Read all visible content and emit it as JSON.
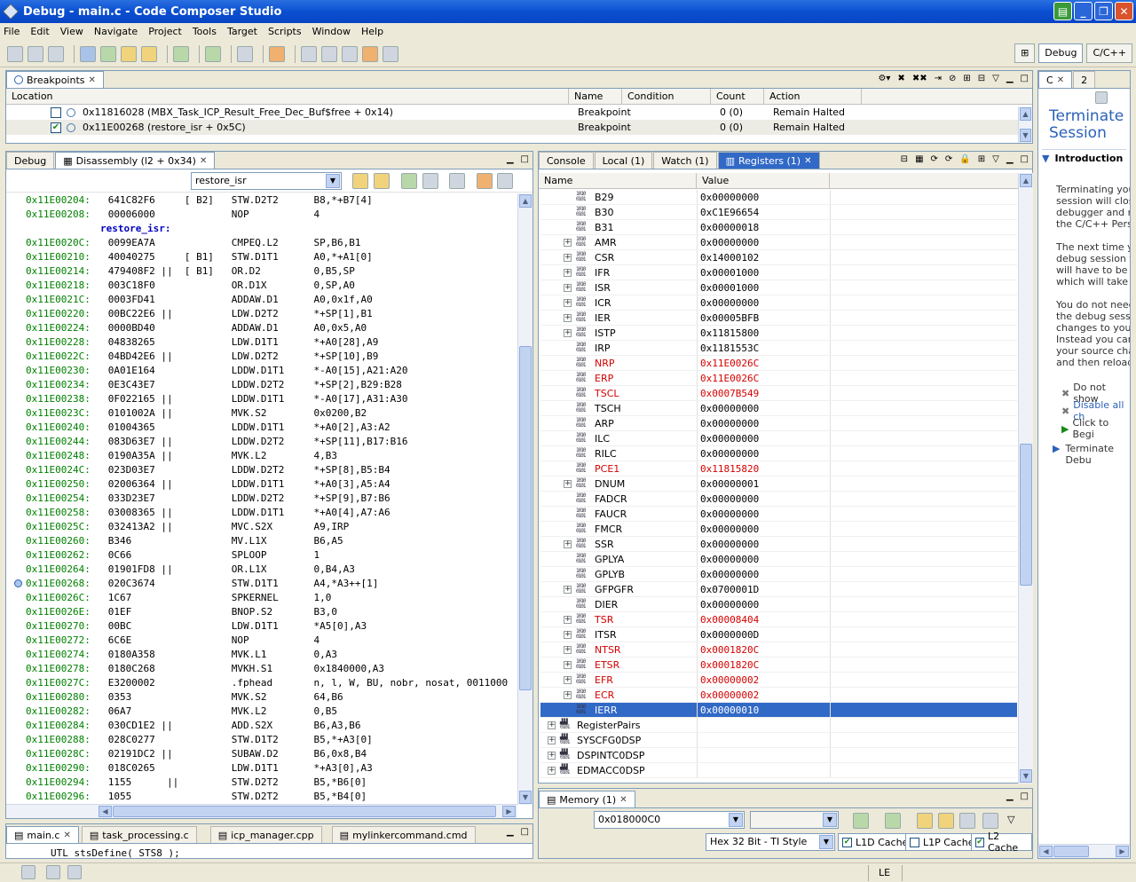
{
  "window": {
    "title": "Debug - main.c - Code Composer Studio"
  },
  "menu": [
    "File",
    "Edit",
    "View",
    "Navigate",
    "Project",
    "Tools",
    "Target",
    "Scripts",
    "Window",
    "Help"
  ],
  "perspectives": {
    "debug": "Debug",
    "cpp": "C/C++"
  },
  "breakpoints": {
    "tab": "Breakpoints",
    "headers": [
      "Location",
      "Name",
      "Condition",
      "Count",
      "Action"
    ],
    "rows": [
      {
        "location": "0x11816028 (MBX_Task_ICP_Result_Free_Dec_Buf$free + 0x14)",
        "name": "Breakpoint",
        "condition": "",
        "count": "0 (0)",
        "action": "Remain Halted",
        "checked": false
      },
      {
        "location": "0x11E00268 (restore_isr + 0x5C)",
        "name": "Breakpoint",
        "condition": "",
        "count": "0 (0)",
        "action": "Remain Halted",
        "checked": true
      }
    ]
  },
  "disassembly": {
    "tab_debug": "Debug",
    "tab": "Disassembly (l2 + 0x34)",
    "location": "restore_isr",
    "lines": [
      {
        "addr": "0x11E00204:",
        "code": "   641C82F6     [ B2]   STW.D2T2      B8,*+B7[4]"
      },
      {
        "addr": "0x11E00208:",
        "code": "   00006000             NOP           4"
      },
      {
        "label": "restore_isr:"
      },
      {
        "addr": "0x11E0020C:",
        "code": "   0099EA7A             CMPEQ.L2      SP,B6,B1"
      },
      {
        "addr": "0x11E00210:",
        "code": "   40040275     [ B1]   STW.D1T1      A0,*+A1[0]"
      },
      {
        "addr": "0x11E00214:",
        "code": "   479408F2 ||  [ B1]   OR.D2         0,B5,SP"
      },
      {
        "addr": "0x11E00218:",
        "code": "   003C18F0             OR.D1X        0,SP,A0"
      },
      {
        "addr": "0x11E0021C:",
        "code": "   0003FD41             ADDAW.D1      A0,0x1f,A0"
      },
      {
        "addr": "0x11E00220:",
        "code": "   00BC22E6 ||          LDW.D2T2      *+SP[1],B1"
      },
      {
        "addr": "0x11E00224:",
        "code": "   0000BD40             ADDAW.D1      A0,0x5,A0"
      },
      {
        "addr": "0x11E00228:",
        "code": "   04838265             LDW.D1T1      *+A0[28],A9"
      },
      {
        "addr": "0x11E0022C:",
        "code": "   04BD42E6 ||          LDW.D2T2      *+SP[10],B9"
      },
      {
        "addr": "0x11E00230:",
        "code": "   0A01E164             LDDW.D1T1     *-A0[15],A21:A20"
      },
      {
        "addr": "0x11E00234:",
        "code": "   0E3C43E7             LDDW.D2T2     *+SP[2],B29:B28"
      },
      {
        "addr": "0x11E00238:",
        "code": "   0F022165 ||          LDDW.D1T1     *-A0[17],A31:A30"
      },
      {
        "addr": "0x11E0023C:",
        "code": "   0101002A ||          MVK.S2        0x0200,B2"
      },
      {
        "addr": "0x11E00240:",
        "code": "   01004365             LDDW.D1T1     *+A0[2],A3:A2"
      },
      {
        "addr": "0x11E00244:",
        "code": "   083D63E7 ||          LDDW.D2T2     *+SP[11],B17:B16"
      },
      {
        "addr": "0x11E00248:",
        "code": "   0190A35A ||          MVK.L2        4,B3"
      },
      {
        "addr": "0x11E0024C:",
        "code": "   023D03E7             LDDW.D2T2     *+SP[8],B5:B4"
      },
      {
        "addr": "0x11E00250:",
        "code": "   02006364 ||          LDDW.D1T1     *+A0[3],A5:A4"
      },
      {
        "addr": "0x11E00254:",
        "code": "   033D23E7             LDDW.D2T2     *+SP[9],B7:B6"
      },
      {
        "addr": "0x11E00258:",
        "code": "   03008365 ||          LDDW.D1T1     *+A0[4],A7:A6"
      },
      {
        "addr": "0x11E0025C:",
        "code": "   032413A2 ||          MVC.S2X       A9,IRP"
      },
      {
        "addr": "0x11E00260:",
        "code": "   B346                 MV.L1X        B6,A5"
      },
      {
        "addr": "0x11E00262:",
        "code": "   0C66                 SPLOOP        1"
      },
      {
        "addr": "0x11E00264:",
        "code": "   01901FD8 ||          OR.L1X        0,B4,A3"
      },
      {
        "addr": "0x11E00268:",
        "code": "   020C3674             STW.D1T1      A4,*A3++[1]",
        "bp": true
      },
      {
        "addr": "0x11E0026C:",
        "code": "   1C67                 SPKERNEL      1,0"
      },
      {
        "addr": "0x11E0026E:",
        "code": "   01EF                 BNOP.S2       B3,0"
      },
      {
        "addr": "0x11E00270:",
        "code": "   00BC                 LDW.D1T1      *A5[0],A3"
      },
      {
        "addr": "0x11E00272:",
        "code": "   6C6E                 NOP           4"
      },
      {
        "addr": "0x11E00274:",
        "code": "   0180A358             MVK.L1        0,A3"
      },
      {
        "addr": "0x11E00278:",
        "code": "   0180C268             MVKH.S1       0x1840000,A3"
      },
      {
        "addr": "0x11E0027C:",
        "code": "   E3200002             .fphead       n, l, W, BU, nobr, nosat, 0011000"
      },
      {
        "addr": "0x11E00280:",
        "code": "   0353                 MVK.S2        64,B6"
      },
      {
        "addr": "0x11E00282:",
        "code": "   06A7                 MVK.L2        0,B5"
      },
      {
        "addr": "0x11E00284:",
        "code": "   030CD1E2 ||          ADD.S2X       B6,A3,B6"
      },
      {
        "addr": "0x11E00288:",
        "code": "   028C0277             STW.D1T2      B5,*+A3[0]"
      },
      {
        "addr": "0x11E0028C:",
        "code": "   02191DC2 ||          SUBAW.D2      B6,0x8,B4"
      },
      {
        "addr": "0x11E00290:",
        "code": "   018C0265             LDW.D1T1      *+A3[0],A3"
      },
      {
        "addr": "0x11E00294:",
        "code": "   1155      ||         STW.D2T2      B5,*B6[0]"
      },
      {
        "addr": "0x11E00296:",
        "code": "   1055                 STW.D2T2      B5,*B4[0]"
      }
    ]
  },
  "editor": {
    "tabs": [
      "main.c",
      "task_processing.c",
      "icp_manager.cpp",
      "mylinkercommand.cmd"
    ],
    "snippet": "UTL_stsDefine( STS8 );"
  },
  "views_tabs": {
    "console": "Console",
    "local": "Local (1)",
    "watch": "Watch (1)",
    "registers": "Registers (1)"
  },
  "registers": {
    "headers": [
      "Name",
      "Value"
    ],
    "rows": [
      {
        "name": "B29",
        "value": "0x00000000"
      },
      {
        "name": "B30",
        "value": "0xC1E96654"
      },
      {
        "name": "B31",
        "value": "0x00000018"
      },
      {
        "name": "AMR",
        "value": "0x00000000",
        "exp": true
      },
      {
        "name": "CSR",
        "value": "0x14000102",
        "exp": true
      },
      {
        "name": "IFR",
        "value": "0x00001000",
        "exp": true
      },
      {
        "name": "ISR",
        "value": "0x00001000",
        "exp": true
      },
      {
        "name": "ICR",
        "value": "0x00000000",
        "exp": true
      },
      {
        "name": "IER",
        "value": "0x00005BFB",
        "exp": true
      },
      {
        "name": "ISTP",
        "value": "0x11815800",
        "exp": true
      },
      {
        "name": "IRP",
        "value": "0x1181553C"
      },
      {
        "name": "NRP",
        "value": "0x11E0026C",
        "red": true
      },
      {
        "name": "ERP",
        "value": "0x11E0026C",
        "red": true
      },
      {
        "name": "TSCL",
        "value": "0x0007B549",
        "red": true
      },
      {
        "name": "TSCH",
        "value": "0x00000000"
      },
      {
        "name": "ARP",
        "value": "0x00000000"
      },
      {
        "name": "ILC",
        "value": "0x00000000"
      },
      {
        "name": "RILC",
        "value": "0x00000000"
      },
      {
        "name": "PCE1",
        "value": "0x11815820",
        "red": true
      },
      {
        "name": "DNUM",
        "value": "0x00000001",
        "exp": true
      },
      {
        "name": "FADCR",
        "value": "0x00000000"
      },
      {
        "name": "FAUCR",
        "value": "0x00000000"
      },
      {
        "name": "FMCR",
        "value": "0x00000000"
      },
      {
        "name": "SSR",
        "value": "0x00000000",
        "exp": true
      },
      {
        "name": "GPLYA",
        "value": "0x00000000"
      },
      {
        "name": "GPLYB",
        "value": "0x00000000"
      },
      {
        "name": "GFPGFR",
        "value": "0x0700001D",
        "exp": true
      },
      {
        "name": "DIER",
        "value": "0x00000000"
      },
      {
        "name": "TSR",
        "value": "0x00008404",
        "exp": true,
        "red": true
      },
      {
        "name": "ITSR",
        "value": "0x0000000D",
        "exp": true
      },
      {
        "name": "NTSR",
        "value": "0x0001820C",
        "exp": true,
        "red": true
      },
      {
        "name": "ETSR",
        "value": "0x0001820C",
        "exp": true,
        "red": true
      },
      {
        "name": "EFR",
        "value": "0x00000002",
        "exp": true,
        "red": true
      },
      {
        "name": "ECR",
        "value": "0x00000002",
        "exp": true,
        "red": true
      },
      {
        "name": "IERR",
        "value": "0x00000010",
        "sel": true
      }
    ],
    "groups": [
      "RegisterPairs",
      "SYSCFG0DSP",
      "DSPINTC0DSP",
      "EDMACC0DSP"
    ]
  },
  "memory": {
    "tab": "Memory (1)",
    "address": "0x018000C0",
    "format": "Hex 32 Bit - TI Style",
    "l1d": "L1D Cache",
    "l1p": "L1P Cache",
    "l2": "L2 Cache"
  },
  "help": {
    "tabs": [
      "C",
      "2"
    ],
    "title": "Terminate Session",
    "intro": "Introduction",
    "paragraphs": [
      "Terminating your",
      "session will close",
      "debugger and re",
      "the C/C++ Persp",
      "",
      "The next time yo",
      "debug session th",
      "will have to be lo",
      "which will take ex",
      "",
      "You do not need",
      "the debug sessio",
      "changes to your",
      "Instead you can",
      "your source char",
      "and then reload y"
    ],
    "actions": [
      "Do not show",
      "Disable all ch",
      "Click to Begi"
    ],
    "terminate_link": "Terminate Debu"
  },
  "status": {
    "mode": "LE"
  }
}
